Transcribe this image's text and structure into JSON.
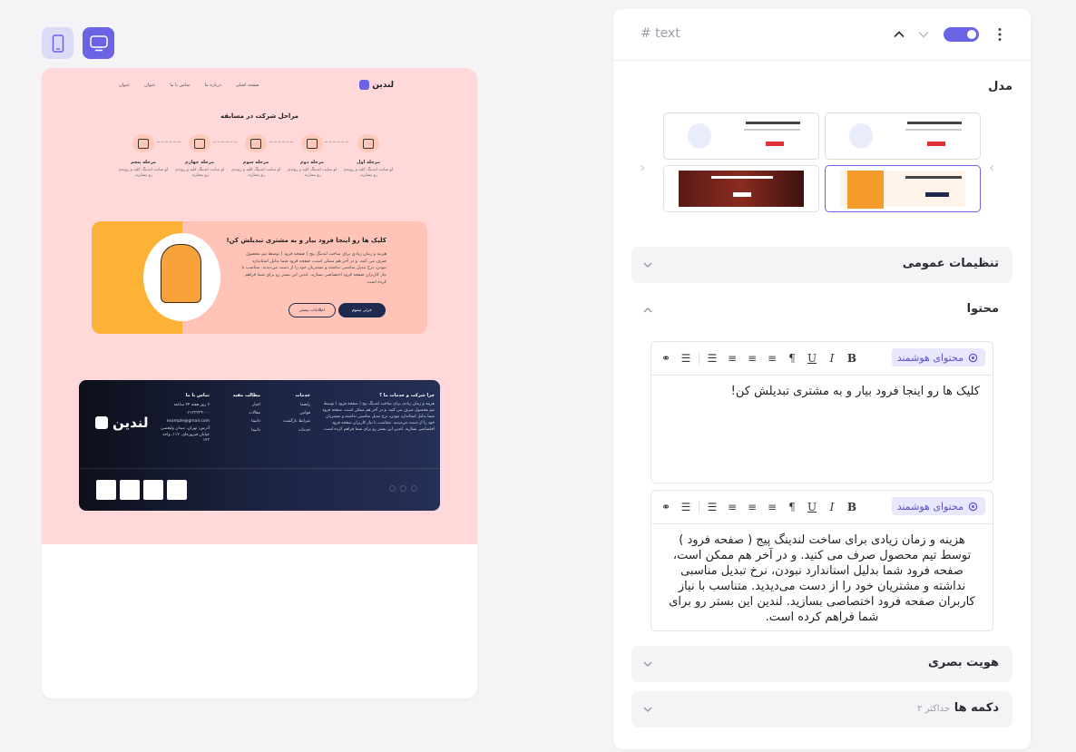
{
  "preview": {
    "nav": {
      "logo": "لندین",
      "menu": [
        "صفحه اصلی",
        "درباره ما",
        "تماس با ما",
        "عنوان",
        "عنوان"
      ]
    },
    "steps_title": "مراحل شرکت در مسابقه",
    "steps": [
      {
        "title": "مرحله اول",
        "desc": "لو سایت لندینگ کلید و روندی رو بسازید."
      },
      {
        "title": "مرحله دوم",
        "desc": "لو سایت لندینگ کلید و روندی رو بسازید."
      },
      {
        "title": "مرحله سوم",
        "desc": "لو سایت لندینگ کلید و روندی رو بسازید."
      },
      {
        "title": "مرحله چهارم",
        "desc": "لو سایت لندینگ کلید و روندی رو بسازید."
      },
      {
        "title": "مرحله پنجم",
        "desc": "لو سایت لندینگ کلید و روندی رو بسازید."
      }
    ],
    "cta": {
      "title": "کلیک ها رو اینجا فرود بیار و به مشتری تبدیلش کن!",
      "text": "هزینه و زمان زیادی برای ساخت لندینگ پیج ( صفحه فرود ) توسط تیم محصول صرف می کنید. و در آخر هم ممکن است، صفحه فرود شما بدلیل استاندارد نبودن، نرخ تبدیل مناسبی نداشته و مشتریان خود را از دست می‌دیدید. متناسب با نیاز کاربران صفحه فرود اختصاصی بسازید. لندین این بستر رو برای شما فراهم کرده است.",
      "primary": "جزئی تیموم",
      "secondary": "اطلاعات بیشتر"
    },
    "footer": {
      "logo": "لندین",
      "about_title": "چرا شرکت و خدمات ما ؟",
      "about_text": "هزینه و زمان زیادی برای ساخت لندینگ پیج ( صفحه فرود ) توسط تیم محصول صرف می کنید. و در آخر هم ممکن است، صفحه فرود شما بدلیل استاندارد نبودن، نرخ تبدیل مناسبی نداشته و مشتریان خود را از دست می‌دیدید. متناسب با نیاز کاربران صفحه فرود اختصاصی بسازید. لندین این بستر رو برای شما فراهم کرده است.",
      "services_title": "خدمات",
      "services": [
        "راهنما",
        "قوانین",
        "شرایط بازگشت",
        "خدمات"
      ],
      "links_title": "مطالب مفید",
      "links": [
        "اخبار",
        "مقالات",
        "دانیما",
        "دانیما"
      ],
      "contact_title": "تماس با ما",
      "contact": [
        "۷ روز هفته ۲۴ ساعته",
        "۰۲۱۳۳۳۳۴۰۰۰",
        "example@gmail.com",
        "آدرس: تهران، میدان ولیعصر، خیابان فیروزه‌ای، ۱۱۲، واحد ۱۲۳"
      ]
    }
  },
  "panel": {
    "header": {
      "hash_text": "# text"
    },
    "model_label": "مدل",
    "sections": {
      "general": "تنظیمات عمومی",
      "content": "محتوا",
      "identity": "هویت بصری",
      "buttons": "دکمه ها",
      "buttons_sub": "حداکثر ۲"
    },
    "editors": [
      {
        "smart_label": "محتوای هوشمند",
        "text": "کلیک ها رو اینجا فرود بیار و به مشتری تبدیلش کن!"
      },
      {
        "smart_label": "محتوای هوشمند",
        "text": "هزینه و زمان زیادی برای ساخت لندینگ پیج ( صفحه فرود ) توسط تیم محصول صرف می کنید. و در آخر هم ممکن است، صفحه فرود شما بدلیل استاندارد نبودن، نرخ تبدیل مناسبی نداشته و مشتریان خود را از دست می‌دیدید. متناسب با نیاز کاربران صفحه فرود اختصاصی بسازید. لندین این بستر رو برای شما فراهم کرده است."
      }
    ],
    "toolbar_icons": [
      "bold-icon",
      "italic-icon",
      "underline-icon",
      "paragraph-icon",
      "align-left-icon",
      "align-center-icon",
      "align-right-icon",
      "align-justify-icon",
      "list-icon",
      "link-icon"
    ],
    "colors": {
      "accent": "#6b63e6",
      "accent_soft": "#e8e7fb",
      "preview_bg": "#ffd9d9",
      "footer_dark": "#1d2545"
    }
  }
}
